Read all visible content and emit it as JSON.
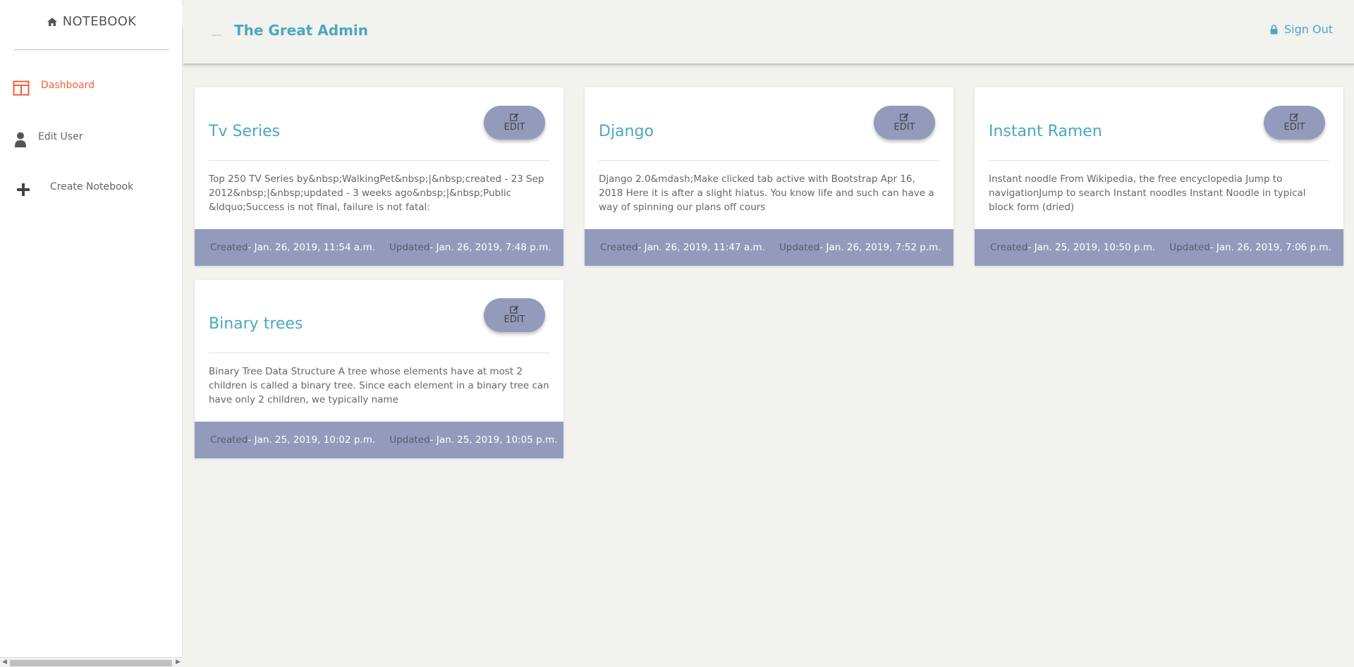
{
  "sidebar": {
    "brand": "NOTEBOOK",
    "brand_icon": "home-icon",
    "items": [
      {
        "label": "Dashboard",
        "icon": "columns-icon",
        "active": true
      },
      {
        "label": "Edit User",
        "icon": "user-icon",
        "active": false
      },
      {
        "label": "Create Notebook",
        "icon": "plus-icon",
        "active": false
      }
    ]
  },
  "header": {
    "title": "The Great Admin",
    "signout_label": "Sign Out",
    "signout_icon": "lock-icon"
  },
  "colors": {
    "accent": "#4ba8c0",
    "active_nav": "#e8643a",
    "card_footer": "#939bbd",
    "background": "#f2f2ee"
  },
  "notebooks": [
    {
      "title": "Tv Series",
      "edit_label": "EDIT",
      "description": "Top 250 TV Series by&nbsp;WalkingPet&nbsp;|&nbsp;created - 23 Sep 2012&nbsp;|&nbsp;updated - 3 weeks ago&nbsp;|&nbsp;Public &ldquo;Success is not final, failure is not fatal:",
      "created_label": "Created",
      "created": "- Jan. 26, 2019, 11:54 a.m.",
      "updated_label": "Updated",
      "updated": "- Jan. 26, 2019, 7:48 p.m."
    },
    {
      "title": "Django",
      "edit_label": "EDIT",
      "description": "Django 2.0&mdash;Make clicked tab active with Bootstrap Apr 16, 2018 Here it is after a slight hiatus. You know life and such can have a way of spinning our plans off cours",
      "created_label": "Created",
      "created": "- Jan. 26, 2019, 11:47 a.m.",
      "updated_label": "Updated",
      "updated": "- Jan. 26, 2019, 7:52 p.m."
    },
    {
      "title": "Instant Ramen",
      "edit_label": "EDIT",
      "description": "Instant noodle From Wikipedia, the free encyclopedia Jump to navigationJump to search Instant noodles Instant Noodle in typical block form (dried)",
      "created_label": "Created",
      "created": "- Jan. 25, 2019, 10:50 p.m.",
      "updated_label": "Updated",
      "updated": "- Jan. 26, 2019, 7:06 p.m."
    },
    {
      "title": "Binary trees",
      "edit_label": "EDIT",
      "description": "Binary Tree Data Structure A tree whose elements have at most 2 children is called a binary tree. Since each element in a binary tree can have only 2 children, we typically name",
      "created_label": "Created",
      "created": "- Jan. 25, 2019, 10:02 p.m.",
      "updated_label": "Updated",
      "updated": "- Jan. 25, 2019, 10:05 p.m."
    }
  ]
}
